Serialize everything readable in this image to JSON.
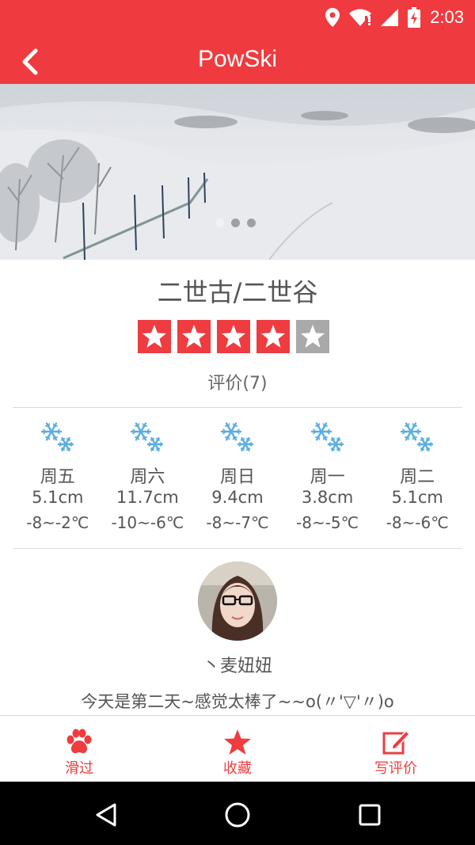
{
  "status_bar": {
    "time": "2:03"
  },
  "app_bar": {
    "title": "PowSki"
  },
  "hero": {
    "slide_count": 3,
    "active_slide": 1
  },
  "resort": {
    "name": "二世古/二世谷",
    "rating": 4,
    "max_rating": 5,
    "review_count": "评价(7)"
  },
  "forecast": [
    {
      "day": "周五",
      "snow": "5.1cm",
      "temp": "-8~-2℃",
      "icon": "snowflake-icon"
    },
    {
      "day": "周六",
      "snow": "11.7cm",
      "temp": "-10~-6℃",
      "icon": "snowflake-icon"
    },
    {
      "day": "周日",
      "snow": "9.4cm",
      "temp": "-8~-7℃",
      "icon": "snowflake-icon"
    },
    {
      "day": "周一",
      "snow": "3.8cm",
      "temp": "-8~-5℃",
      "icon": "snowflake-icon"
    },
    {
      "day": "周二",
      "snow": "5.1cm",
      "temp": "-8~-6℃",
      "icon": "snowflake-icon"
    }
  ],
  "review": {
    "reviewer": "丶麦妞妞",
    "text": "今天是第二天~感觉太棒了~~o(〃'▽'〃)o"
  },
  "tabs": [
    {
      "label": "滑过",
      "icon": "paw-icon"
    },
    {
      "label": "收藏",
      "icon": "star-icon"
    },
    {
      "label": "写评价",
      "icon": "edit-icon"
    }
  ],
  "colors": {
    "primary": "#ef3b3f",
    "star_empty": "#a9a9a9",
    "snow_icon": "#5aaee0"
  }
}
